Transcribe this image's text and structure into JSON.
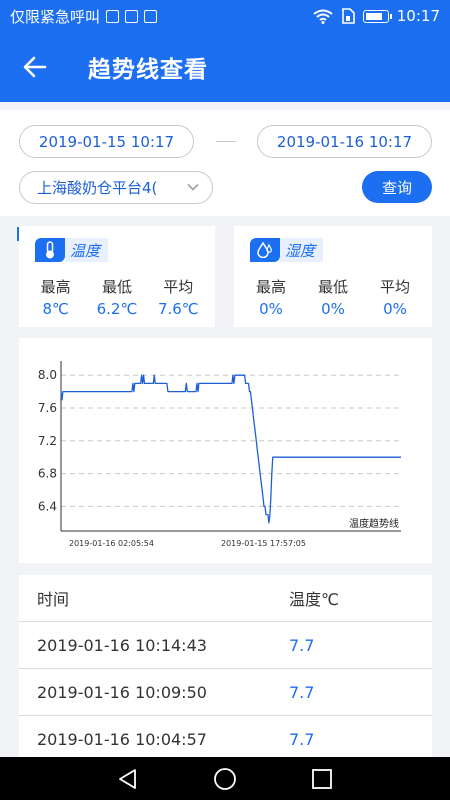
{
  "status_bar": {
    "left_text": "仅限紧急呼叫",
    "time": "10:17"
  },
  "header": {
    "title": "趋势线查看"
  },
  "filter": {
    "start_time": "2019-01-15 10:17",
    "end_time": "2019-01-16 10:17",
    "site": "上海酸奶仓平台4(",
    "query_label": "查询"
  },
  "temperature": {
    "label": "温度",
    "max_label": "最高",
    "min_label": "最低",
    "avg_label": "平均",
    "max": "8℃",
    "min": "6.2℃",
    "avg": "7.6℃"
  },
  "humidity": {
    "label": "湿度",
    "max_label": "最高",
    "min_label": "最低",
    "avg_label": "平均",
    "max": "0%",
    "min": "0%",
    "avg": "0%"
  },
  "chart_data": {
    "type": "line",
    "legend": "温度趋势线",
    "x_tick_labels": [
      "2019-01-16 02:05:54",
      "2019-01-15 17:57:05"
    ],
    "y_ticks": [
      "8.0",
      "7.6",
      "7.2",
      "6.8",
      "6.4"
    ],
    "ylim": [
      6.1,
      8.1
    ],
    "grid": true,
    "series": [
      {
        "values": [
          7.8,
          7.7,
          7.8,
          7.8,
          7.8,
          7.8,
          7.8,
          7.8,
          7.8,
          7.8,
          7.8,
          7.8,
          7.8,
          7.8,
          7.8,
          7.8,
          7.8,
          7.8,
          7.8,
          7.8,
          7.8,
          7.8,
          7.8,
          7.8,
          7.8,
          7.8,
          7.8,
          7.8,
          7.8,
          7.8,
          7.8,
          7.8,
          7.8,
          7.8,
          7.8,
          7.8,
          7.8,
          7.8,
          7.8,
          7.8,
          7.8,
          7.8,
          7.8,
          7.8,
          7.8,
          7.8,
          7.8,
          7.8,
          7.8,
          7.8,
          7.8,
          7.8,
          7.8,
          7.8,
          7.8,
          7.8,
          7.8,
          7.8,
          7.8,
          7.8,
          7.8,
          7.8,
          7.8,
          7.8,
          7.8,
          7.8,
          7.8,
          7.8,
          7.8,
          7.8,
          7.8,
          7.8,
          7.8,
          7.8,
          7.9,
          7.8,
          7.9,
          7.9,
          7.9,
          7.9,
          7.9,
          7.9,
          7.9,
          8.0,
          7.9,
          8.0,
          7.9,
          7.9,
          7.9,
          7.9,
          7.9,
          7.9,
          7.9,
          7.9,
          7.9,
          7.9,
          8.0,
          7.9,
          7.9,
          7.9,
          7.9,
          7.9,
          7.9,
          7.9,
          7.9,
          7.9,
          7.9,
          7.9,
          7.9,
          7.9,
          7.8,
          7.8,
          7.8,
          7.8,
          7.8,
          7.8,
          7.8,
          7.8,
          7.8,
          7.8,
          7.8,
          7.8,
          7.8,
          7.8,
          7.8,
          7.8,
          7.8,
          7.8,
          7.8,
          7.9,
          7.8,
          7.8,
          7.8,
          7.8,
          7.8,
          7.8,
          7.8,
          7.8,
          7.8,
          7.8,
          7.9,
          7.8,
          7.9,
          7.9,
          7.9,
          7.9,
          7.9,
          7.9,
          7.9,
          7.9,
          7.9,
          7.9,
          7.9,
          7.9,
          7.9,
          7.9,
          7.9,
          7.9,
          7.9,
          7.9,
          7.9,
          7.9,
          7.9,
          7.9,
          7.9,
          7.9,
          7.9,
          7.9,
          7.9,
          7.9,
          7.9,
          7.9,
          7.9,
          7.9,
          7.9,
          7.9,
          7.9,
          8.0,
          7.9,
          8.0,
          8.0,
          8.0,
          8.0,
          8.0,
          8.0,
          8.0,
          8.0,
          8.0,
          8.0,
          8.0,
          7.9,
          7.9,
          7.9,
          7.9,
          7.8,
          7.8,
          7.7,
          7.6,
          7.5,
          7.4,
          7.3,
          7.2,
          7.1,
          7.0,
          6.9,
          6.8,
          6.7,
          6.6,
          6.5,
          6.4,
          6.4,
          6.3,
          6.3,
          6.3,
          6.2,
          6.3,
          6.5,
          6.8,
          7.0,
          7.0,
          7.0,
          7.0,
          7.0,
          7.0,
          7.0,
          7.0,
          7.0,
          7.0,
          7.0,
          7.0,
          7.0,
          7.0,
          7.0,
          7.0,
          7.0,
          7.0,
          7.0,
          7.0,
          7.0,
          7.0,
          7.0,
          7.0,
          7.0,
          7.0,
          7.0,
          7.0,
          7.0,
          7.0,
          7.0,
          7.0,
          7.0,
          7.0,
          7.0,
          7.0,
          7.0,
          7.0,
          7.0,
          7.0,
          7.0,
          7.0,
          7.0,
          7.0,
          7.0,
          7.0,
          7.0,
          7.0,
          7.0,
          7.0,
          7.0,
          7.0,
          7.0,
          7.0,
          7.0,
          7.0,
          7.0,
          7.0,
          7.0,
          7.0,
          7.0,
          7.0,
          7.0,
          7.0,
          7.0,
          7.0,
          7.0,
          7.0,
          7.0,
          7.0,
          7.0,
          7.0,
          7.0,
          7.0,
          7.0,
          7.0,
          7.0,
          7.0,
          7.0,
          7.0,
          7.0,
          7.0,
          7.0,
          7.0,
          7.0,
          7.0,
          7.0,
          7.0,
          7.0,
          7.0,
          7.0,
          7.0,
          7.0,
          7.0,
          7.0,
          7.0,
          7.0,
          7.0,
          7.0,
          7.0,
          7.0,
          7.0,
          7.0,
          7.0,
          7.0,
          7.0,
          7.0,
          7.0,
          7.0,
          7.0,
          7.0,
          7.0,
          7.0,
          7.0,
          7.0,
          7.0,
          7.0,
          7.0,
          7.0,
          7.0,
          7.0,
          7.0,
          7.0,
          7.0,
          7.0,
          7.0,
          7.0,
          7.0,
          7.0,
          7.0,
          7.0,
          7.0,
          7.0
        ]
      }
    ],
    "color": "#1d5fd6"
  },
  "table": {
    "headers": {
      "time": "时间",
      "temp": "温度℃"
    },
    "rows": [
      {
        "time": "2019-01-16 10:14:43",
        "temp": "7.7"
      },
      {
        "time": "2019-01-16 10:09:50",
        "temp": "7.7"
      },
      {
        "time": "2019-01-16 10:04:57",
        "temp": "7.7"
      }
    ]
  },
  "colors": {
    "primary": "#1d6ff2",
    "value_blue": "#1d5fd6"
  }
}
